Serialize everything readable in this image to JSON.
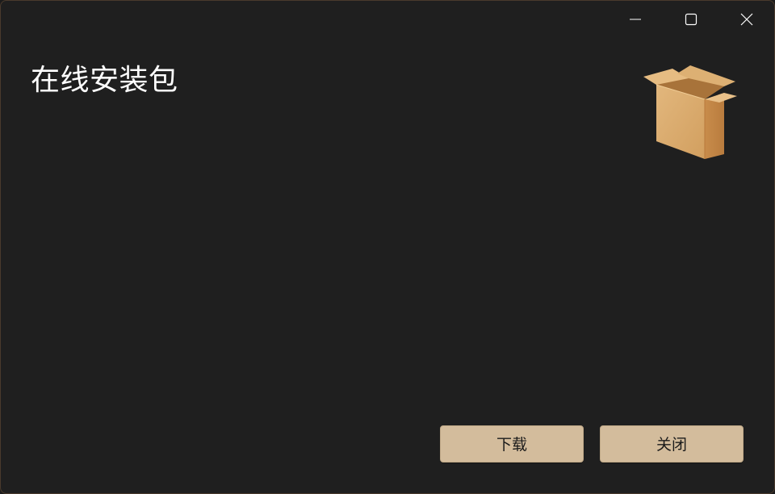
{
  "window": {
    "title": "在线安装包",
    "controls": {
      "minimize_icon": "minimize-icon",
      "maximize_icon": "maximize-icon",
      "close_icon": "close-icon"
    }
  },
  "icon": {
    "name": "package-box-icon",
    "colors": {
      "box_front": "#d9a96a",
      "box_side": "#c98f4e",
      "flap": "#e3b878"
    }
  },
  "buttons": {
    "download_label": "下载",
    "close_label": "关闭",
    "color": "#d3bc9c"
  },
  "theme": {
    "background": "#1f1f1f",
    "border": "#4a3a2c",
    "text": "#ffffff"
  }
}
